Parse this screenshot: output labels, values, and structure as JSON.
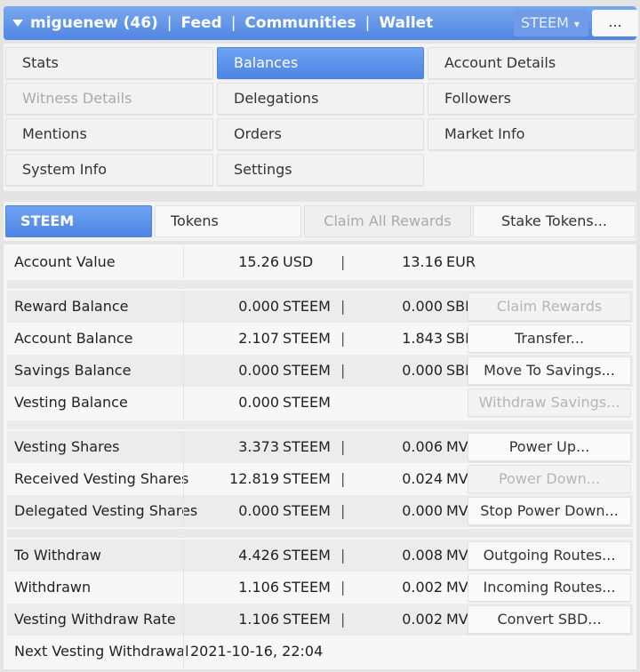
{
  "topbar": {
    "account": "miguenew (46)",
    "feed": "Feed",
    "communities": "Communities",
    "wallet": "Wallet",
    "separator": "|",
    "coin": "STEEM",
    "more": "..."
  },
  "menu": [
    {
      "label": "Stats",
      "state": "normal"
    },
    {
      "label": "Balances",
      "state": "active"
    },
    {
      "label": "Account Details",
      "state": "normal"
    },
    {
      "label": "Witness Details",
      "state": "disabled"
    },
    {
      "label": "Delegations",
      "state": "normal"
    },
    {
      "label": "Followers",
      "state": "normal"
    },
    {
      "label": "Mentions",
      "state": "normal"
    },
    {
      "label": "Orders",
      "state": "normal"
    },
    {
      "label": "Market Info",
      "state": "normal"
    },
    {
      "label": "System Info",
      "state": "normal"
    },
    {
      "label": "Settings",
      "state": "normal"
    }
  ],
  "tabs": {
    "steem": "STEEM",
    "tokens": "Tokens",
    "claim_all": "Claim All Rewards",
    "stake_tokens": "Stake Tokens..."
  },
  "account_value": {
    "label": "Account Value",
    "v1": "15.26",
    "u1": "USD",
    "sep": "|",
    "v2": "13.16",
    "u2": "EUR"
  },
  "rows": [
    {
      "label": "Reward Balance",
      "v1": "0.000",
      "u1": "STEEM",
      "sep": "|",
      "v2": "0.000",
      "u2": "SBD",
      "action": "Claim Rewards",
      "action_disabled": true
    },
    {
      "label": "Account Balance",
      "v1": "2.107",
      "u1": "STEEM",
      "sep": "|",
      "v2": "1.843",
      "u2": "SBD",
      "action": "Transfer...",
      "action_disabled": false
    },
    {
      "label": "Savings Balance",
      "v1": "0.000",
      "u1": "STEEM",
      "sep": "|",
      "v2": "0.000",
      "u2": "SBD",
      "action": "Move To Savings...",
      "action_disabled": false
    },
    {
      "label": "Vesting Balance",
      "v1": "0.000",
      "u1": "STEEM",
      "sep": "",
      "v2": "",
      "u2": "",
      "action": "Withdraw Savings...",
      "action_disabled": true
    },
    {
      "label": "Vesting Shares",
      "v1": "3.373",
      "u1": "STEEM",
      "sep": "|",
      "v2": "0.006",
      "u2": "MVests",
      "action": "Power Up...",
      "action_disabled": false
    },
    {
      "label": "Received Vesting Shares",
      "v1": "12.819",
      "u1": "STEEM",
      "sep": "|",
      "v2": "0.024",
      "u2": "MVests",
      "action": "Power Down...",
      "action_disabled": true
    },
    {
      "label": "Delegated Vesting Shares",
      "v1": "0.000",
      "u1": "STEEM",
      "sep": "|",
      "v2": "0.000",
      "u2": "MVests",
      "action": "Stop Power Down...",
      "action_disabled": false
    },
    {
      "label": "To Withdraw",
      "v1": "4.426",
      "u1": "STEEM",
      "sep": "|",
      "v2": "0.008",
      "u2": "MVests",
      "action": "Outgoing Routes...",
      "action_disabled": false
    },
    {
      "label": "Withdrawn",
      "v1": "1.106",
      "u1": "STEEM",
      "sep": "|",
      "v2": "0.002",
      "u2": "MVests",
      "action": "Incoming Routes...",
      "action_disabled": false
    },
    {
      "label": "Vesting Withdraw Rate",
      "v1": "1.106",
      "u1": "STEEM",
      "sep": "|",
      "v2": "0.002",
      "u2": "MVests",
      "action": "Convert SBD...",
      "action_disabled": false
    }
  ],
  "next_withdrawal": {
    "label": "Next Vesting Withdrawal",
    "value": "2021-10-16, 22:04"
  }
}
